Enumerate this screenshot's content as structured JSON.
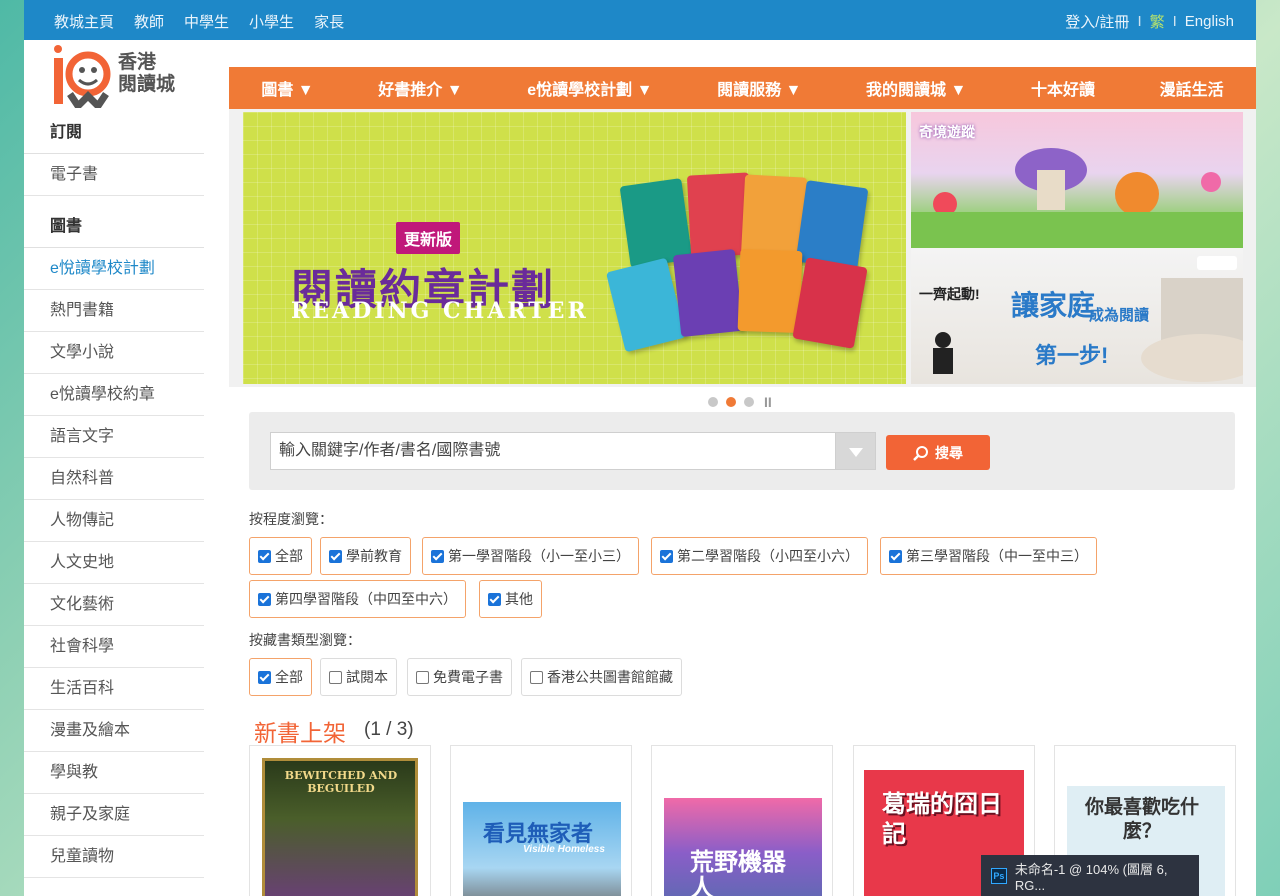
{
  "topbar": {
    "links": [
      "教城主頁",
      "教師",
      "中學生",
      "小學生",
      "家長"
    ],
    "login": "登入/註冊",
    "lang_trad": "繁",
    "lang_en": "English"
  },
  "logo": {
    "line1": "香港",
    "line2": "閱讀城"
  },
  "sidebar": {
    "sections": [
      {
        "heading": "訂閱",
        "items": [
          "電子書"
        ]
      },
      {
        "heading": "圖書",
        "items": [
          "e悅讀學校計劃",
          "熱門書籍",
          "文學小說",
          "e悅讀學校約章",
          "語言文字",
          "自然科普",
          "人物傳記",
          "人文史地",
          "文化藝術",
          "社會科學",
          "生活百科",
          "漫畫及繪本",
          "學與教",
          "親子及家庭",
          "兒童讀物"
        ]
      }
    ]
  },
  "mainnav": {
    "items": [
      "圖書 ▼",
      "好書推介 ▼",
      "e悅讀學校計劃 ▼",
      "閱讀服務 ▼",
      "我的閱讀城 ▼",
      "十本好讀",
      "漫話生活"
    ]
  },
  "banner": {
    "badge": "更新版",
    "title": "閱讀約章計劃",
    "subtitle": "READING CHARTER",
    "side1_label": "奇境遊蹤",
    "side2_start": "一齊起動!",
    "side2_big": "讓家庭",
    "side2_small1": "成為閱讀",
    "side2_small2": "第一步!",
    "pause": "II"
  },
  "search": {
    "placeholder": "輸入關鍵字/作者/書名/國際書號",
    "button": "搜尋"
  },
  "filters": {
    "level_label": "按程度瀏覽：",
    "levels": [
      {
        "label": "全部",
        "checked": true
      },
      {
        "label": "學前教育",
        "checked": true
      },
      {
        "label": "第一學習階段（小一至小三）",
        "checked": true
      },
      {
        "label": "第二學習階段（小四至小六）",
        "checked": true
      },
      {
        "label": "第三學習階段（中一至中三）",
        "checked": true
      },
      {
        "label": "第四學習階段（中四至中六）",
        "checked": true
      },
      {
        "label": "其他",
        "checked": true
      }
    ],
    "type_label": "按藏書類型瀏覽：",
    "types": [
      {
        "label": "全部",
        "checked": true
      },
      {
        "label": "試閱本",
        "checked": false
      },
      {
        "label": "免費電子書",
        "checked": false
      },
      {
        "label": "香港公共圖書館館藏",
        "checked": false
      }
    ]
  },
  "newbooks": {
    "title": "新書上架",
    "count": "(1 / 3)",
    "covers": [
      {
        "text": "BEWITCHED AND BEGUILED"
      },
      {
        "text": "看見無家者",
        "sub": "Visible Homeless"
      },
      {
        "text": "荒野機器人"
      },
      {
        "text": "葛瑞的囧日記"
      },
      {
        "text": "你最喜歡吃什麼？"
      }
    ]
  },
  "taskbar": {
    "text": "未命名-1 @ 104% (圖層 6, RG...",
    "icon": "Ps"
  },
  "colors": {
    "topbar": "#1e88c8",
    "nav": "#f07a36",
    "accent": "#f26436",
    "check": "#1a73d9"
  }
}
